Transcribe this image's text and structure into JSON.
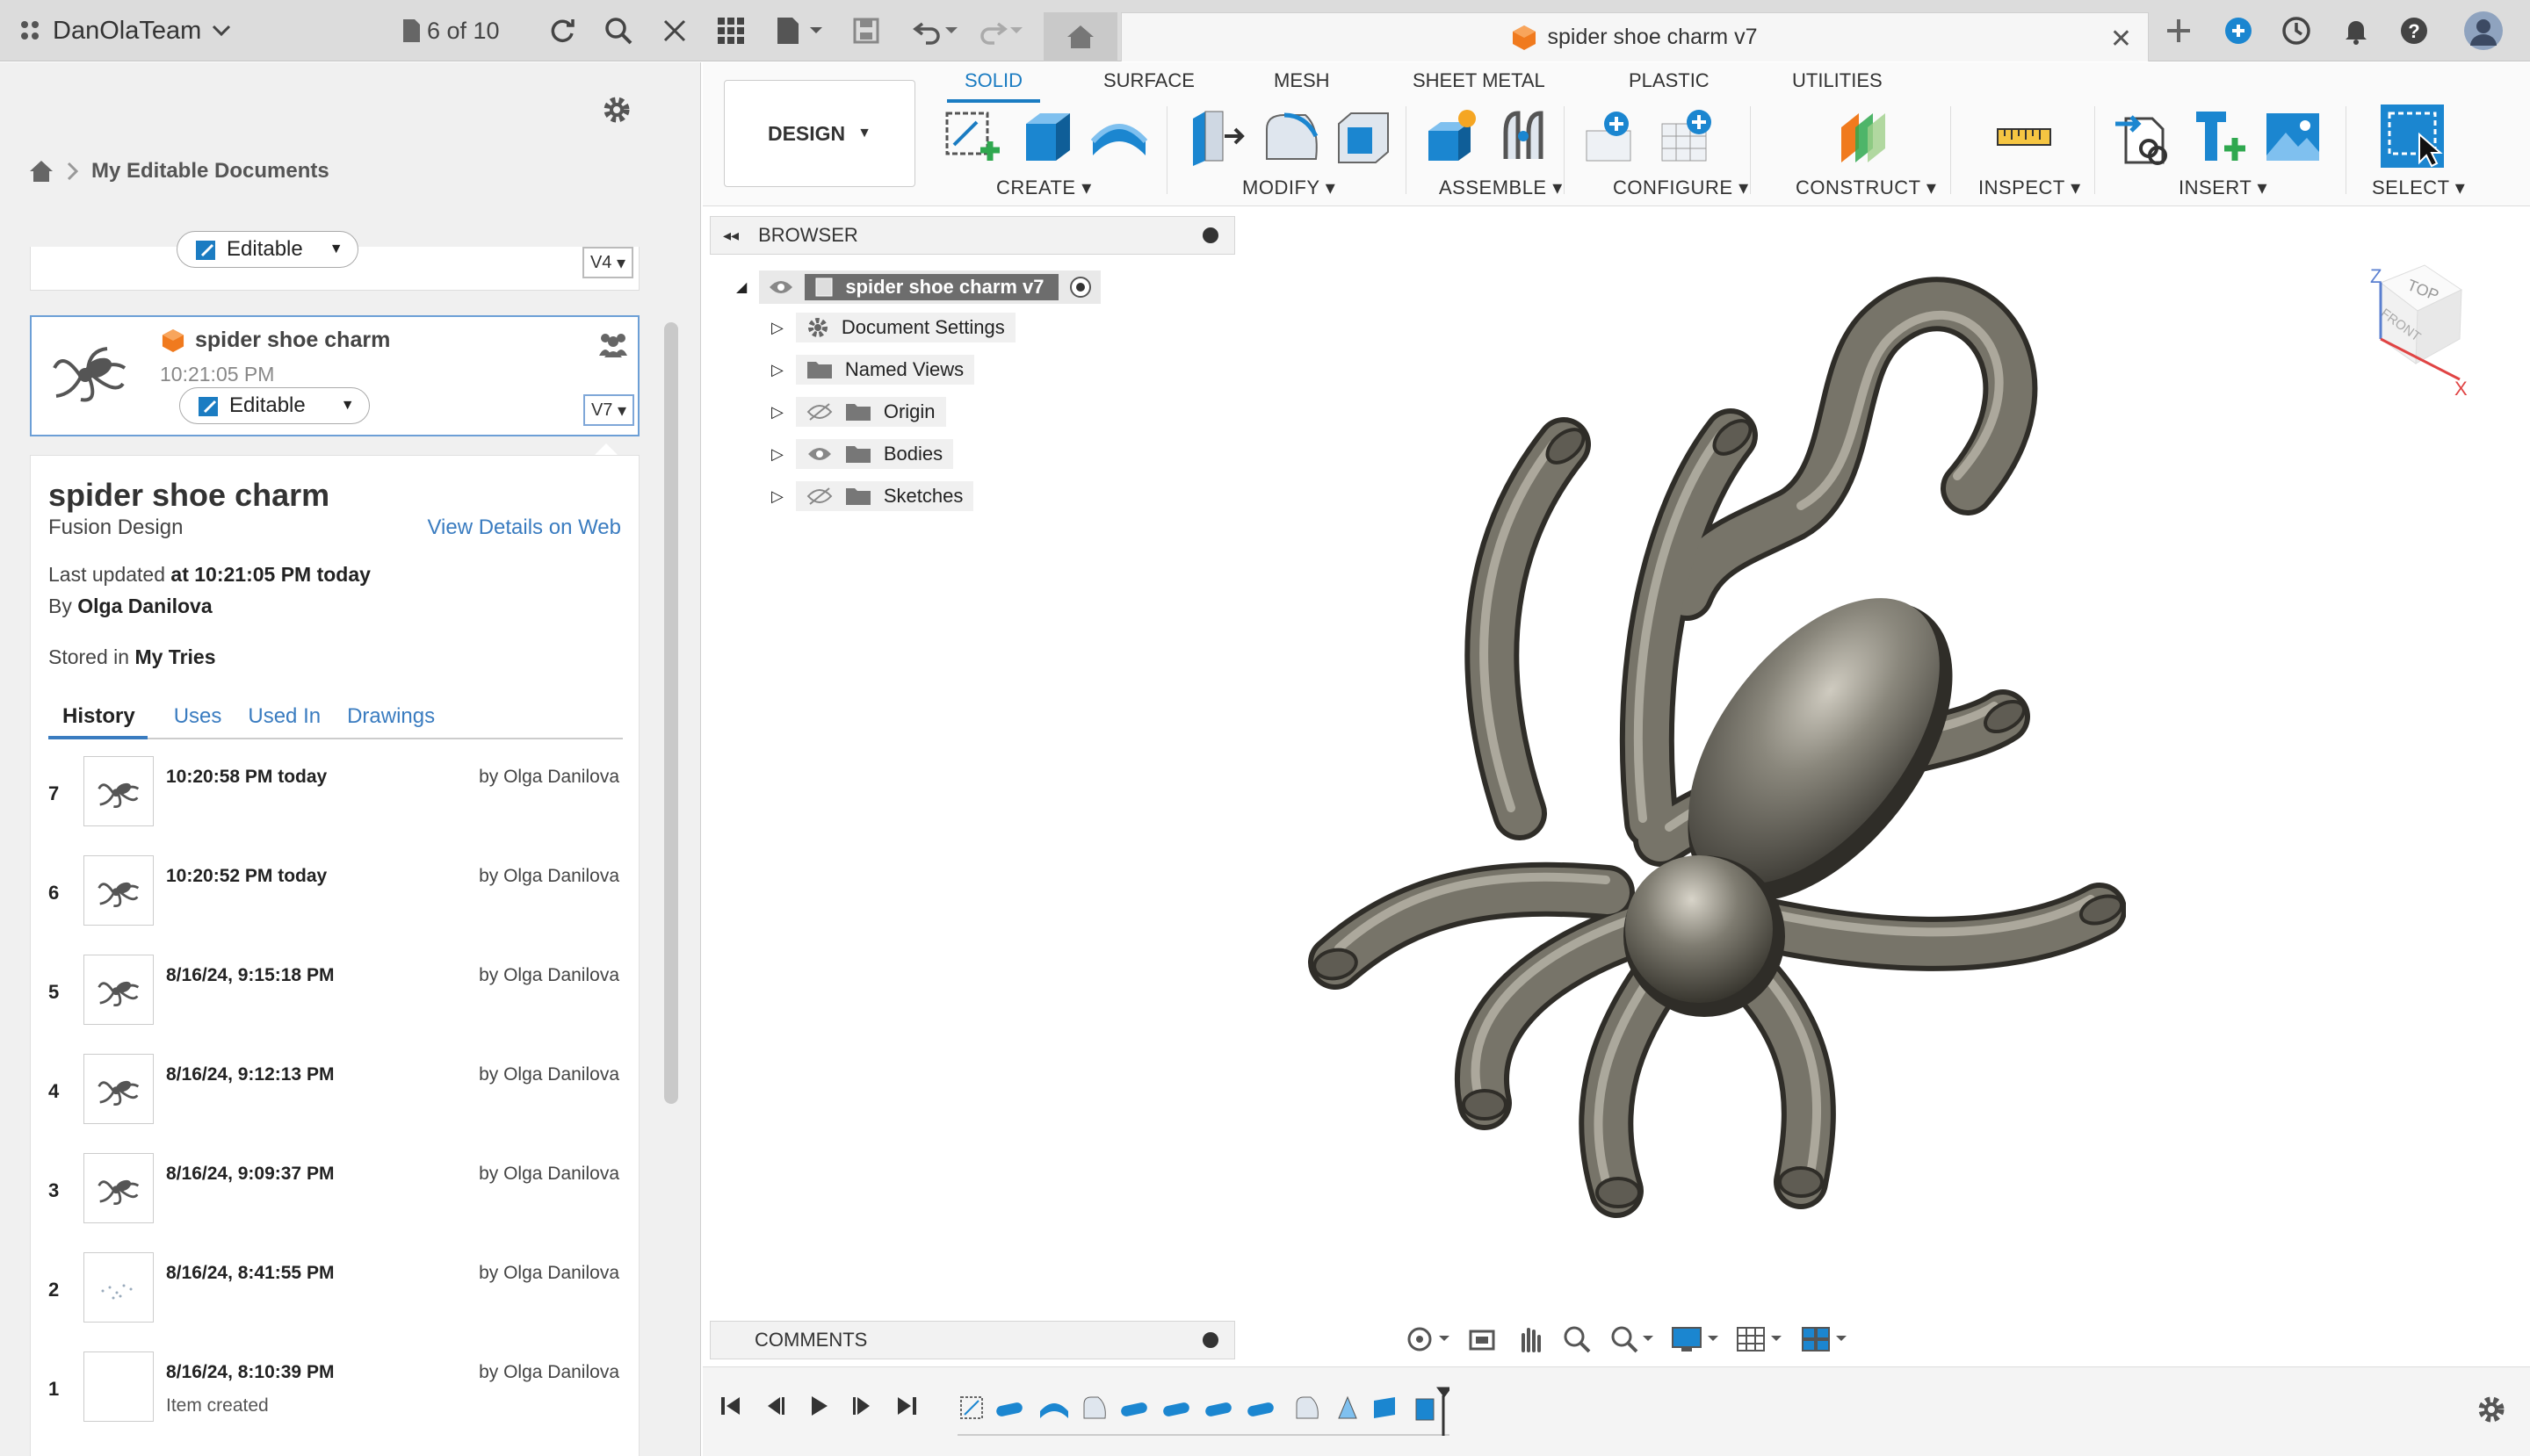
{
  "titlebar": {
    "team_name": "DanOlaTeam",
    "doc_count": "6 of 10",
    "tab_title": "spider shoe charm v7",
    "icons": [
      "apps-icon",
      "chevron-down-icon",
      "doc-count-icon",
      "refresh-icon",
      "search-icon",
      "close-icon",
      "grid-icon",
      "file-icon",
      "save-icon",
      "undo-icon",
      "redo-icon",
      "home-icon",
      "new-tab-icon",
      "extensions-icon",
      "job-status-icon",
      "notifications-icon",
      "help-icon",
      "user-avatar"
    ]
  },
  "left_panel": {
    "breadcrumb": "My Editable Documents",
    "partial_card": {
      "badge": "Editable",
      "version": "V4"
    },
    "selected_card": {
      "name": "spider shoe charm",
      "time": "10:21:05 PM",
      "badge": "Editable",
      "version": "V7"
    },
    "details": {
      "title": "spider shoe charm",
      "type": "Fusion Design",
      "view_link": "View Details on Web",
      "updated_prefix": "Last updated",
      "updated_value": "at 10:21:05 PM today",
      "by_prefix": "By",
      "by_value": "Olga Danilova",
      "stored_prefix": "Stored in",
      "stored_value": "My Tries",
      "tabs": [
        "History",
        "Uses",
        "Used In",
        "Drawings"
      ],
      "history": [
        {
          "num": "7",
          "time": "10:20:58 PM today",
          "by": "by Olga Danilova",
          "note": ""
        },
        {
          "num": "6",
          "time": "10:20:52 PM today",
          "by": "by Olga Danilova",
          "note": ""
        },
        {
          "num": "5",
          "time": "8/16/24, 9:15:18 PM",
          "by": "by Olga Danilova",
          "note": ""
        },
        {
          "num": "4",
          "time": "8/16/24, 9:12:13 PM",
          "by": "by Olga Danilova",
          "note": ""
        },
        {
          "num": "3",
          "time": "8/16/24, 9:09:37 PM",
          "by": "by Olga Danilova",
          "note": ""
        },
        {
          "num": "2",
          "time": "8/16/24, 8:41:55 PM",
          "by": "by Olga Danilova",
          "note": ""
        },
        {
          "num": "1",
          "time": "8/16/24, 8:10:39 PM",
          "by": "by Olga Danilova",
          "note": "Item created"
        }
      ]
    }
  },
  "toolbar": {
    "workspace": "DESIGN",
    "tabs": [
      "SOLID",
      "SURFACE",
      "MESH",
      "SHEET METAL",
      "PLASTIC",
      "UTILITIES"
    ],
    "active_tab": "SOLID",
    "groups": [
      "CREATE",
      "MODIFY",
      "ASSEMBLE",
      "CONFIGURE",
      "CONSTRUCT",
      "INSPECT",
      "INSERT",
      "SELECT"
    ]
  },
  "browser": {
    "header": "BROWSER",
    "root": "spider shoe charm v7",
    "items": [
      "Document Settings",
      "Named Views",
      "Origin",
      "Bodies",
      "Sketches"
    ]
  },
  "viewcube": {
    "top": "TOP",
    "front": "FRONT",
    "z": "Z",
    "x": "X"
  },
  "comments": {
    "label": "COMMENTS"
  },
  "colors": {
    "accent": "#1b7cc2",
    "model": "#6e6b62",
    "titlebar": "#dcdcdc",
    "orange": "#f07a1e"
  }
}
